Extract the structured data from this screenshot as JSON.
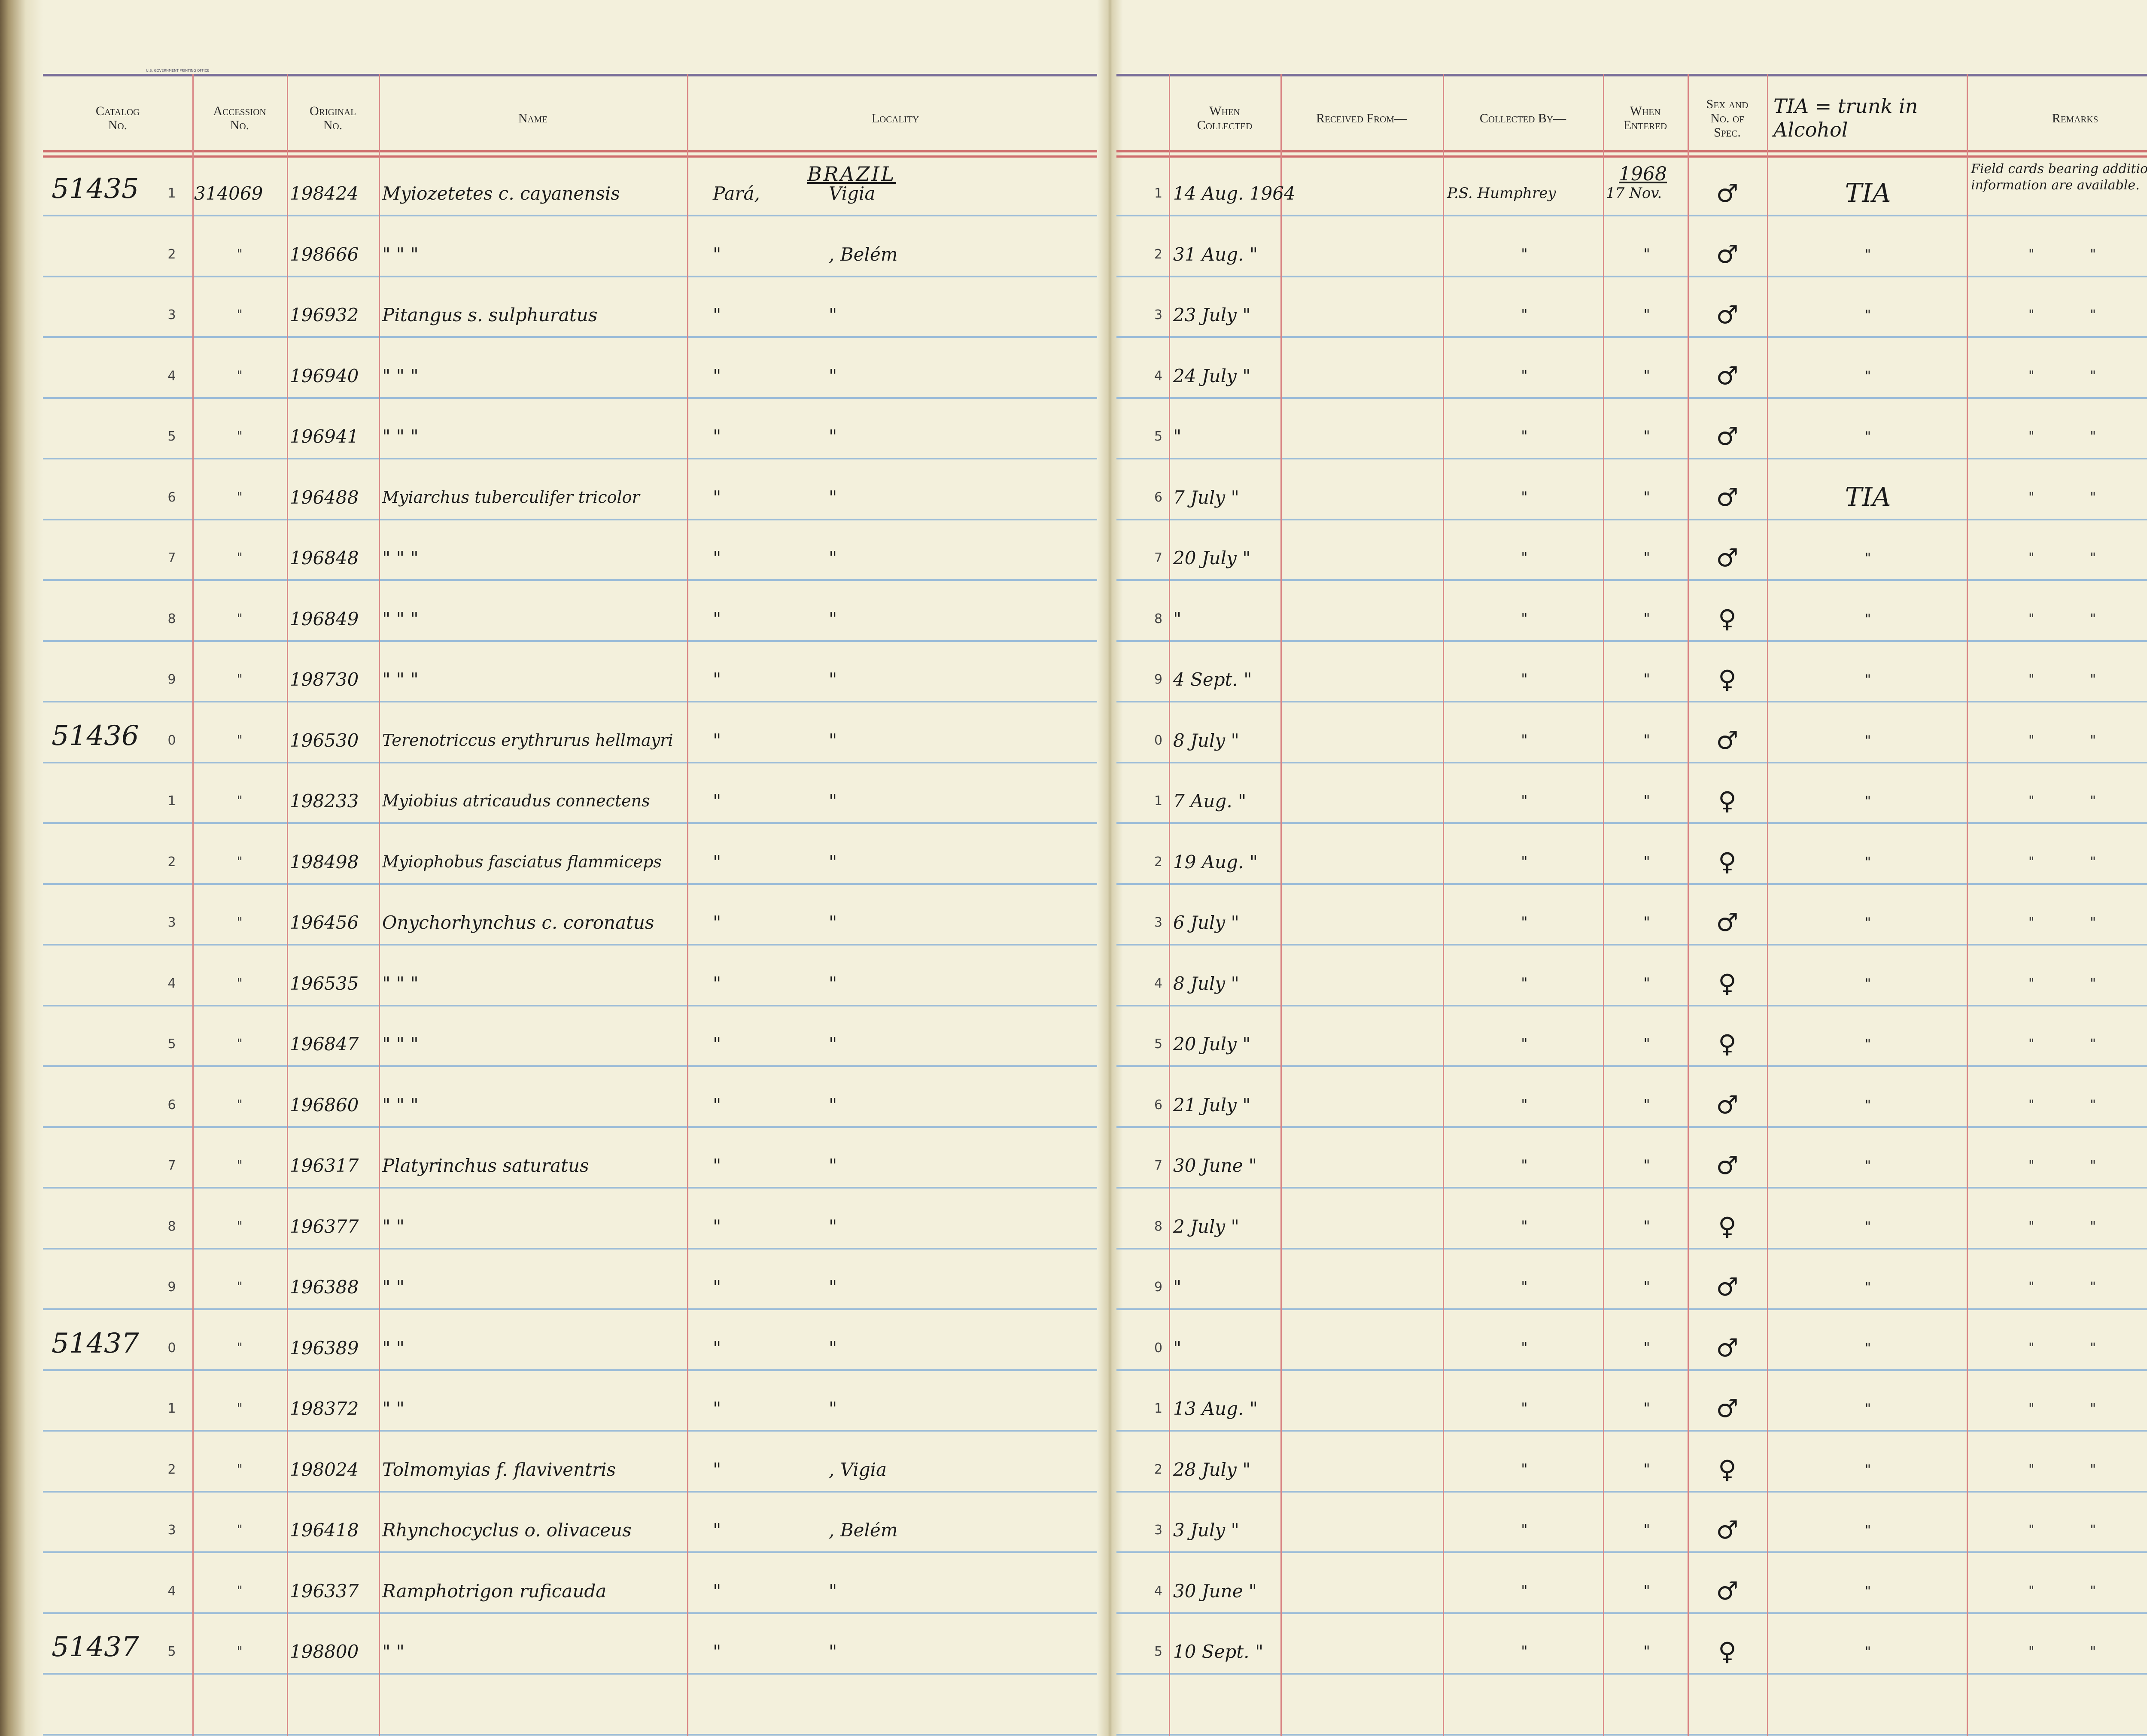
{
  "header": {
    "left_columns": [
      "Catalog\nNo.",
      "Accession\nNo.",
      "Original\nNo.",
      "Name",
      "Locality"
    ],
    "right_columns": [
      "When\nCollected",
      "Received From—",
      "Collected By—",
      "When\nEntered",
      "Sex and\nNo. of\nSpec.",
      "",
      "Remarks"
    ],
    "tia_note": "TIA = trunk in Alcohol",
    "printer_line": "U.S. GOVERNMENT PRINTING OFFICE"
  },
  "section": {
    "country": "BRAZIL",
    "year_entered": "1968",
    "remarks_note": "Field cards bearing additional information are available."
  },
  "rows": [
    {
      "catalog": "51435",
      "digit": "1",
      "accession": "314069",
      "original": "198424",
      "name": "Myiozetetes c. cayanensis",
      "loc1": "Pará,",
      "loc2": "Vigia",
      "wdigit": "1",
      "collected": "14 Aug. 1964",
      "by": "P.S. Humphrey",
      "entered": "17 Nov.",
      "sex": "♂",
      "tia": "TIA",
      "remarks": ""
    },
    {
      "catalog": "",
      "digit": "2",
      "accession": "\"",
      "original": "198666",
      "name": "\"  \"  \"",
      "loc1": "\"",
      "loc2": ", Belém",
      "wdigit": "2",
      "collected": "31 Aug. \"",
      "by": "\"",
      "entered": "\"",
      "sex": "♂",
      "tia": "\"",
      "remarks": "\"   \""
    },
    {
      "catalog": "",
      "digit": "3",
      "accession": "\"",
      "original": "196932",
      "name": "Pitangus s. sulphuratus",
      "loc1": "\"",
      "loc2": "\"",
      "wdigit": "3",
      "collected": "23 July \"",
      "by": "\"",
      "entered": "\"",
      "sex": "♂",
      "tia": "\"",
      "remarks": "\"   \""
    },
    {
      "catalog": "",
      "digit": "4",
      "accession": "\"",
      "original": "196940",
      "name": "\"  \"  \"",
      "loc1": "\"",
      "loc2": "\"",
      "wdigit": "4",
      "collected": "24 July \"",
      "by": "\"",
      "entered": "\"",
      "sex": "♂",
      "tia": "\"",
      "remarks": "\"   \""
    },
    {
      "catalog": "",
      "digit": "5",
      "accession": "\"",
      "original": "196941",
      "name": "\"  \"  \"",
      "loc1": "\"",
      "loc2": "\"",
      "wdigit": "5",
      "collected": "\"",
      "by": "\"",
      "entered": "\"",
      "sex": "♂",
      "tia": "\"",
      "remarks": "\"   \""
    },
    {
      "catalog": "",
      "digit": "6",
      "accession": "\"",
      "original": "196488",
      "name": "Myiarchus tuberculifer tricolor",
      "loc1": "\"",
      "loc2": "\"",
      "wdigit": "6",
      "collected": "7 July \"",
      "by": "\"",
      "entered": "\"",
      "sex": "♂",
      "tia": "TIA",
      "remarks": "\"   \""
    },
    {
      "catalog": "",
      "digit": "7",
      "accession": "\"",
      "original": "196848",
      "name": "\"  \"  \"",
      "loc1": "\"",
      "loc2": "\"",
      "wdigit": "7",
      "collected": "20 July \"",
      "by": "\"",
      "entered": "\"",
      "sex": "♂",
      "tia": "\"",
      "remarks": "\"   \""
    },
    {
      "catalog": "",
      "digit": "8",
      "accession": "\"",
      "original": "196849",
      "name": "\"  \"  \"",
      "loc1": "\"",
      "loc2": "\"",
      "wdigit": "8",
      "collected": "\"",
      "by": "\"",
      "entered": "\"",
      "sex": "♀",
      "tia": "\"",
      "remarks": "\"   \""
    },
    {
      "catalog": "",
      "digit": "9",
      "accession": "\"",
      "original": "198730",
      "name": "\"  \"  \"",
      "loc1": "\"",
      "loc2": "\"",
      "wdigit": "9",
      "collected": "4 Sept. \"",
      "by": "\"",
      "entered": "\"",
      "sex": "♀",
      "tia": "\"",
      "remarks": "\"   \""
    },
    {
      "catalog": "51436",
      "digit": "0",
      "accession": "\"",
      "original": "196530",
      "name": "Terenotriccus erythrurus hellmayri",
      "loc1": "\"",
      "loc2": "\"",
      "wdigit": "0",
      "collected": "8 July \"",
      "by": "\"",
      "entered": "\"",
      "sex": "♂",
      "tia": "\"",
      "remarks": "\"   \""
    },
    {
      "catalog": "",
      "digit": "1",
      "accession": "\"",
      "original": "198233",
      "name": "Myiobius atricaudus connectens",
      "loc1": "\"",
      "loc2": "\"",
      "wdigit": "1",
      "collected": "7 Aug. \"",
      "by": "\"",
      "entered": "\"",
      "sex": "♀",
      "tia": "\"",
      "remarks": "\"   \""
    },
    {
      "catalog": "",
      "digit": "2",
      "accession": "\"",
      "original": "198498",
      "name": "Myiophobus fasciatus flammiceps",
      "loc1": "\"",
      "loc2": "\"",
      "wdigit": "2",
      "collected": "19 Aug. \"",
      "by": "\"",
      "entered": "\"",
      "sex": "♀",
      "tia": "\"",
      "remarks": "\"   \""
    },
    {
      "catalog": "",
      "digit": "3",
      "accession": "\"",
      "original": "196456",
      "name": "Onychorhynchus c. coronatus",
      "loc1": "\"",
      "loc2": "\"",
      "wdigit": "3",
      "collected": "6 July \"",
      "by": "\"",
      "entered": "\"",
      "sex": "♂",
      "tia": "\"",
      "remarks": "\"   \""
    },
    {
      "catalog": "",
      "digit": "4",
      "accession": "\"",
      "original": "196535",
      "name": "\"  \"  \"",
      "loc1": "\"",
      "loc2": "\"",
      "wdigit": "4",
      "collected": "8 July \"",
      "by": "\"",
      "entered": "\"",
      "sex": "♀",
      "tia": "\"",
      "remarks": "\"   \""
    },
    {
      "catalog": "",
      "digit": "5",
      "accession": "\"",
      "original": "196847",
      "name": "\"  \"  \"",
      "loc1": "\"",
      "loc2": "\"",
      "wdigit": "5",
      "collected": "20 July \"",
      "by": "\"",
      "entered": "\"",
      "sex": "♀",
      "tia": "\"",
      "remarks": "\"   \""
    },
    {
      "catalog": "",
      "digit": "6",
      "accession": "\"",
      "original": "196860",
      "name": "\"  \"  \"",
      "loc1": "\"",
      "loc2": "\"",
      "wdigit": "6",
      "collected": "21 July \"",
      "by": "\"",
      "entered": "\"",
      "sex": "♂",
      "tia": "\"",
      "remarks": "\"   \""
    },
    {
      "catalog": "",
      "digit": "7",
      "accession": "\"",
      "original": "196317",
      "name": "Platyrinchus saturatus",
      "loc1": "\"",
      "loc2": "\"",
      "wdigit": "7",
      "collected": "30 June \"",
      "by": "\"",
      "entered": "\"",
      "sex": "♂",
      "tia": "\"",
      "remarks": "\"   \""
    },
    {
      "catalog": "",
      "digit": "8",
      "accession": "\"",
      "original": "196377",
      "name": "\"  \"",
      "loc1": "\"",
      "loc2": "\"",
      "wdigit": "8",
      "collected": "2 July \"",
      "by": "\"",
      "entered": "\"",
      "sex": "♀",
      "tia": "\"",
      "remarks": "\"   \""
    },
    {
      "catalog": "",
      "digit": "9",
      "accession": "\"",
      "original": "196388",
      "name": "\"  \"",
      "loc1": "\"",
      "loc2": "\"",
      "wdigit": "9",
      "collected": "\"",
      "by": "\"",
      "entered": "\"",
      "sex": "♂",
      "tia": "\"",
      "remarks": "\"   \""
    },
    {
      "catalog": "51437",
      "digit": "0",
      "accession": "\"",
      "original": "196389",
      "name": "\"  \"",
      "loc1": "\"",
      "loc2": "\"",
      "wdigit": "0",
      "collected": "\"",
      "by": "\"",
      "entered": "\"",
      "sex": "♂",
      "tia": "\"",
      "remarks": "\"   \""
    },
    {
      "catalog": "",
      "digit": "1",
      "accession": "\"",
      "original": "198372",
      "name": "\"  \"",
      "loc1": "\"",
      "loc2": "\"",
      "wdigit": "1",
      "collected": "13 Aug. \"",
      "by": "\"",
      "entered": "\"",
      "sex": "♂",
      "tia": "\"",
      "remarks": "\"   \""
    },
    {
      "catalog": "",
      "digit": "2",
      "accession": "\"",
      "original": "198024",
      "name": "Tolmomyias f. flaviventris",
      "loc1": "\"",
      "loc2": ", Vigia",
      "wdigit": "2",
      "collected": "28 July \"",
      "by": "\"",
      "entered": "\"",
      "sex": "♀",
      "tia": "\"",
      "remarks": "\"   \""
    },
    {
      "catalog": "",
      "digit": "3",
      "accession": "\"",
      "original": "196418",
      "name": "Rhynchocyclus o. olivaceus",
      "loc1": "\"",
      "loc2": ", Belém",
      "wdigit": "3",
      "collected": "3 July \"",
      "by": "\"",
      "entered": "\"",
      "sex": "♂",
      "tia": "\"",
      "remarks": "\"   \""
    },
    {
      "catalog": "",
      "digit": "4",
      "accession": "\"",
      "original": "196337",
      "name": "Ramphotrigon ruficauda",
      "loc1": "\"",
      "loc2": "\"",
      "wdigit": "4",
      "collected": "30 June \"",
      "by": "\"",
      "entered": "\"",
      "sex": "♂",
      "tia": "\"",
      "remarks": "\"   \""
    },
    {
      "catalog": "51437",
      "digit": "5",
      "accession": "\"",
      "original": "198800",
      "name": "\"  \"",
      "loc1": "\"",
      "loc2": "\"",
      "wdigit": "5",
      "collected": "10 Sept. \"",
      "by": "\"",
      "entered": "\"",
      "sex": "♀",
      "tia": "\"",
      "remarks": "\"   \""
    }
  ]
}
